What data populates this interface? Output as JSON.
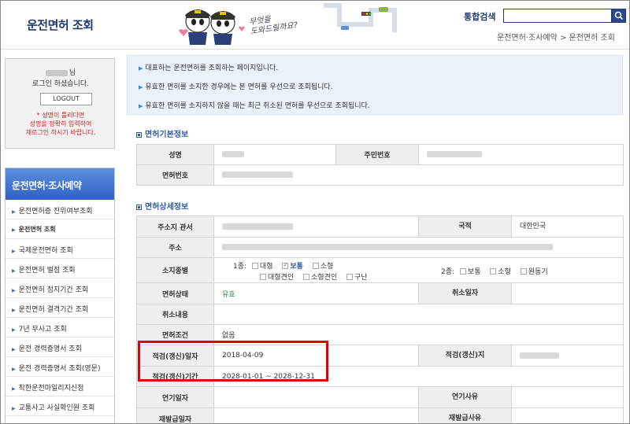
{
  "header": {
    "title": "운전면허 조회",
    "speech": "무엇을\n도와드릴까요?",
    "search_label": "통합검색",
    "search_placeholder": "",
    "breadcrumb": "운전면허·조사예약 > 운전면허 조회"
  },
  "login": {
    "name_suffix": "님",
    "message": "로그인 하셨습니다.",
    "logout": "LOGOUT",
    "warning": "* 성명이 틀리다면\n성명을 정확히 입력하여\n재로그인 하시기 바랍니다."
  },
  "nav": {
    "header": "운전면허·조사예약",
    "items": [
      {
        "label": "운전면허증 진위여부조회"
      },
      {
        "label": "운전면허 조회"
      },
      {
        "label": "국제운전면허 조회"
      },
      {
        "label": "운전면허 벌점 조회"
      },
      {
        "label": "운전면허 정지기간 조회"
      },
      {
        "label": "운전면허 결격기간 조회"
      },
      {
        "label": "7년 무사고 조회"
      },
      {
        "label": "운전 경력증명서 조회"
      },
      {
        "label": "운전 경력증명서 조회(영문)"
      },
      {
        "label": "착한운전마일리지신청"
      },
      {
        "label": "교통사고 사실확인원 조회"
      }
    ]
  },
  "notice": [
    "대표하는 운전면허를 조회하는 페이지입니다.",
    "유효한 면허를 소지한 경우에는 본 면허를 우선으로 조회됩니다.",
    "유효한 면허를 소지하지 않을 때는 최근 취소된 면허를 우선으로 조회됩니다."
  ],
  "basic": {
    "title": "면허기본정보",
    "name_label": "성명",
    "ssn_label": "주민번호",
    "license_no_label": "면허번호"
  },
  "detail": {
    "title": "면허상세정보",
    "office_label": "주소지 관서",
    "nationality_label": "국적",
    "nationality_value": "대한민국",
    "address_label": "주소",
    "type_label": "소지종별",
    "class1_label": "1종:",
    "class1_options": [
      "대형",
      "보통",
      "소형",
      "대형견인",
      "소형견인",
      "구난"
    ],
    "class2_label": "2종:",
    "class2_options": [
      "보통",
      "소형",
      "원동기"
    ],
    "status_label": "면허상태",
    "status_value": "유효",
    "cancel_date_label": "취소일자",
    "cancel_content_label": "취소내용",
    "condition_label": "면허조건",
    "condition_value": "없음",
    "renewal_date_label": "적검(갱신)일자",
    "renewal_date_value": "2018-04-09",
    "renewal_place_label": "적검(갱신)지",
    "renewal_period_label": "적검(갱신)기간",
    "renewal_period_value": "2028-01-01 ~ 2028-12-31",
    "extend_date_label": "연기일자",
    "extend_reason_label": "연기사유",
    "reissue_date_label": "재발급일자",
    "reissue_reason_label": "재발급사유"
  },
  "colors": {
    "accent": "#2f5ba8",
    "nav_header": "#3a6fd0",
    "highlight": "#e00000",
    "status_green": "#2f8a40"
  }
}
